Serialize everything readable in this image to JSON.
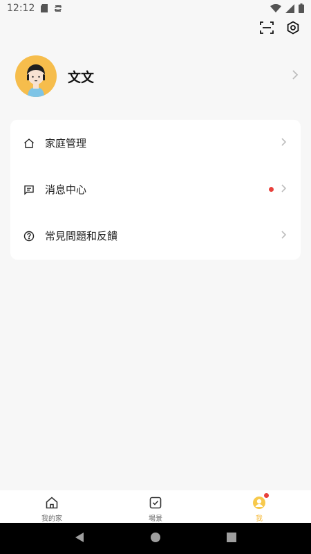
{
  "status_bar": {
    "time": "12:12"
  },
  "profile": {
    "username": "文文"
  },
  "menu": {
    "items": [
      {
        "label": "家庭管理",
        "icon": "home-outline-icon"
      },
      {
        "label": "消息中心",
        "icon": "message-icon",
        "has_badge": true
      },
      {
        "label": "常見問題和反饋",
        "icon": "help-circle-icon"
      }
    ]
  },
  "tabs": [
    {
      "label": "我的家",
      "icon": "home-icon"
    },
    {
      "label": "場景",
      "icon": "scene-check-icon"
    },
    {
      "label": "我",
      "icon": "me-icon",
      "active": true
    }
  ],
  "colors": {
    "accent": "#f5b62d",
    "badge": "#e8413c",
    "avatar_bg": "#f6bd4c",
    "background": "#f7f7f7"
  }
}
